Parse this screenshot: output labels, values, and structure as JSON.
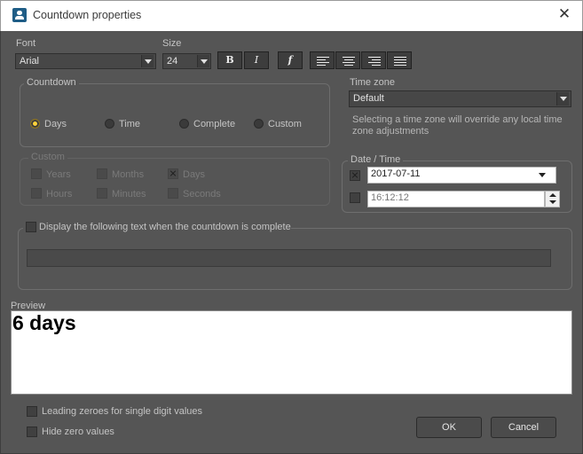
{
  "window": {
    "title": "Countdown properties"
  },
  "font": {
    "label": "Font",
    "value": "Arial"
  },
  "size": {
    "label": "Size",
    "value": "24"
  },
  "format_buttons": {
    "bold": "B",
    "italic": "I",
    "function": "f"
  },
  "countdown": {
    "legend": "Countdown",
    "options": [
      {
        "label": "Days",
        "selected": true
      },
      {
        "label": "Time",
        "selected": false
      },
      {
        "label": "Complete",
        "selected": false
      },
      {
        "label": "Custom",
        "selected": false
      }
    ]
  },
  "custom": {
    "legend": "Custom",
    "items": [
      {
        "label": "Years",
        "checked": false
      },
      {
        "label": "Months",
        "checked": false
      },
      {
        "label": "Days",
        "checked": true
      },
      {
        "label": "Hours",
        "checked": false
      },
      {
        "label": "Minutes",
        "checked": false
      },
      {
        "label": "Seconds",
        "checked": false
      }
    ]
  },
  "timezone": {
    "label": "Time zone",
    "value": "Default",
    "note": "Selecting a time zone will override any local time zone adjustments"
  },
  "datetime": {
    "legend": "Date / Time",
    "date": "2017-07-11",
    "time": "16:12:12"
  },
  "complete_text": {
    "label": "Display the following text when the countdown is complete",
    "value": ""
  },
  "preview": {
    "label": "Preview",
    "text": "6 days"
  },
  "options": {
    "leading_zeroes": "Leading zeroes for single digit values",
    "hide_zero": "Hide zero values"
  },
  "buttons": {
    "ok": "OK",
    "cancel": "Cancel"
  }
}
